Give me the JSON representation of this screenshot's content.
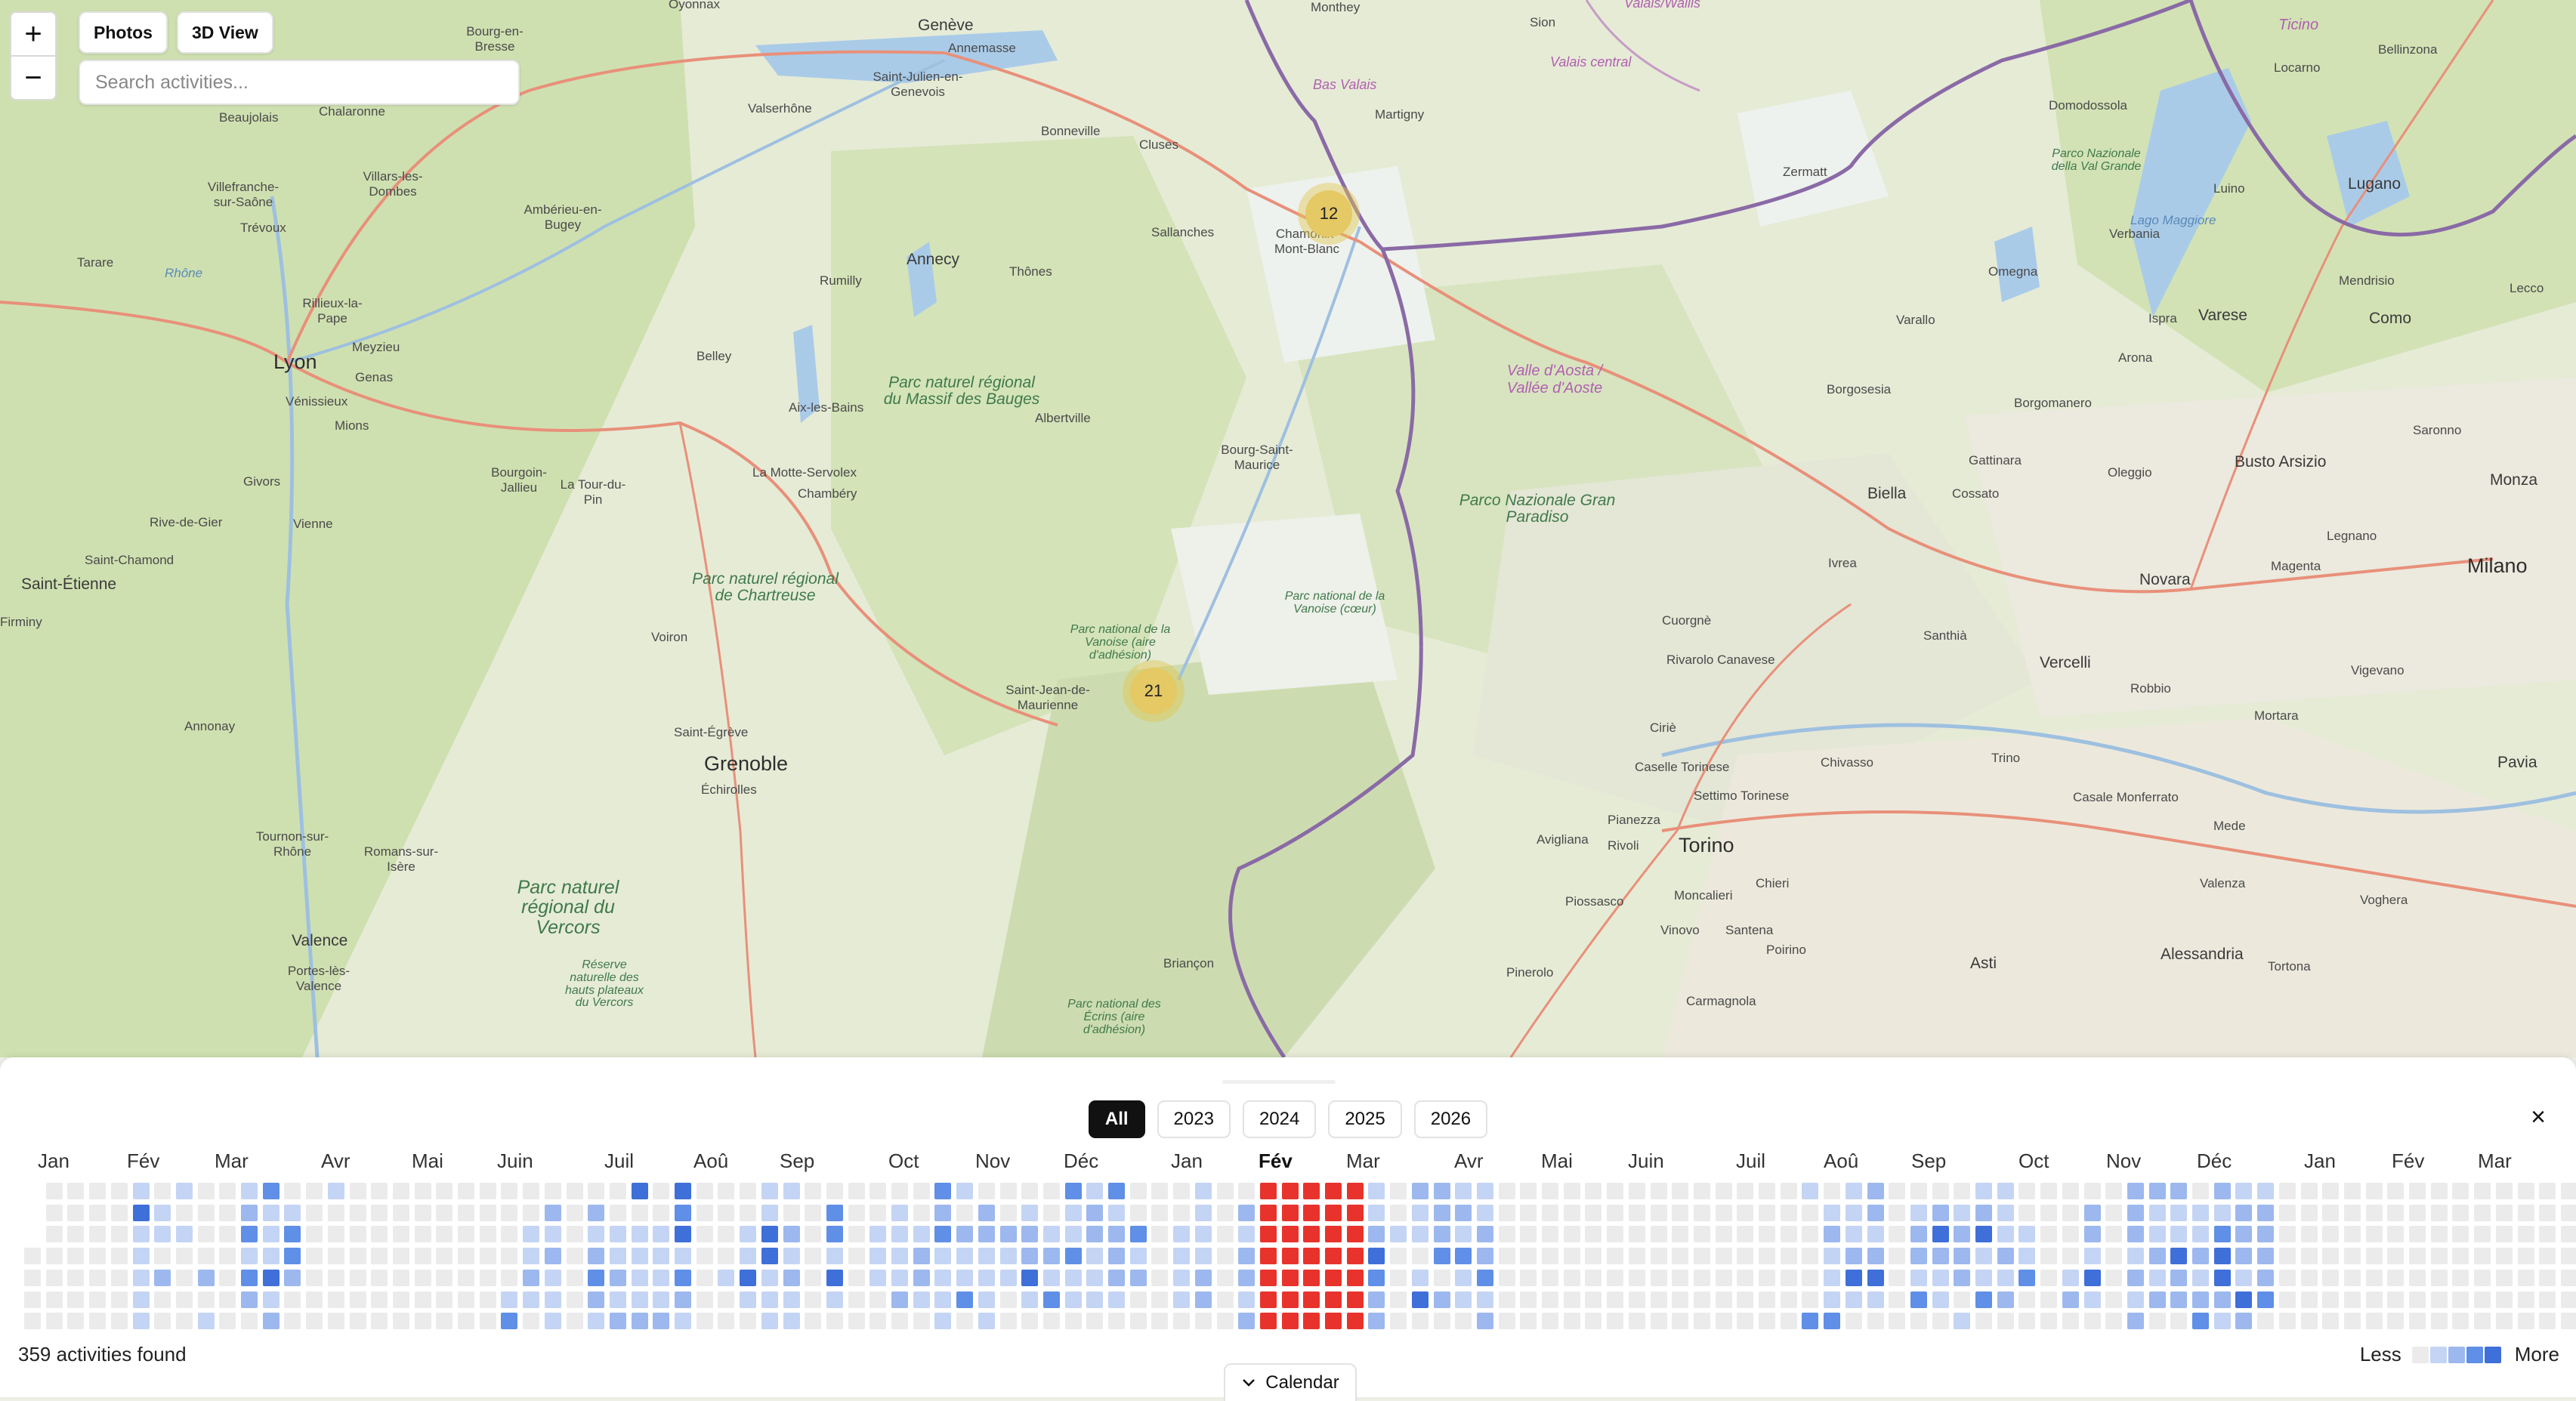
{
  "map": {
    "zoom_in": "+",
    "zoom_out": "−",
    "buttons": {
      "photos": "Photos",
      "threed": "3D View"
    },
    "search": {
      "placeholder": "Search activities..."
    },
    "clusters": [
      {
        "count": "12"
      },
      {
        "count": "21"
      }
    ],
    "labels": {
      "oyonnax": "Oyonnax",
      "geneve": "Genève",
      "annemasse": "Annemasse",
      "monthey": "Monthey",
      "sion": "Sion",
      "valais": "Valais/Wallis",
      "bourg_en_bresse": "Bourg-en-Bresse",
      "saint_julien": "Saint-Julien-en-Genevois",
      "bonneville": "Bonneville",
      "valserhone": "Valserhône",
      "chalaronne": "Chalaronne",
      "beaujolais": "Beaujolais",
      "villars": "Villars-les-Dombes",
      "villefranche": "Villefranche-sur-Saône",
      "trevoux": "Trévoux",
      "amberieu": "Ambérieu-en-Bugey",
      "tarare": "Tarare",
      "rhone": "Rhône",
      "rillieux": "Rillieux-la-Pape",
      "lyon": "Lyon",
      "venissieux": "Vénissieux",
      "meyzieu": "Meyzieu",
      "genas": "Genas",
      "mions": "Mions",
      "annecy": "Annecy",
      "rumilly": "Rumilly",
      "thones": "Thônes",
      "cluses": "Cluses",
      "sallanches": "Sallanches",
      "chamonix": "Chamonix-Mont-Blanc",
      "martigny": "Martigny",
      "bas_valais": "Bas Valais",
      "valais_central": "Valais central",
      "zermatt": "Zermatt",
      "domodossola": "Domodossola",
      "locarno": "Locarno",
      "bellinzona": "Bellinzona",
      "ticino": "Ticino",
      "lugano": "Lugano",
      "luino": "Luino",
      "verbania": "Verbania",
      "lago_maggiore": "Lago Maggiore",
      "mendrisio": "Mendrisio",
      "como": "Como",
      "lecco": "Lecco",
      "varese": "Varese",
      "omegna": "Omegna",
      "varallo": "Varallo",
      "ispra": "Ispra",
      "arona": "Arona",
      "borgosesia": "Borgosesia",
      "borgomanero": "Borgomanero",
      "gattinara": "Gattinara",
      "busto": "Busto Arsizio",
      "biella": "Biella",
      "cossato": "Cossato",
      "oleggio": "Oleggio",
      "novara": "Novara",
      "magenta": "Magenta",
      "milano": "Milano",
      "monza": "Monza",
      "belley": "Belley",
      "aix": "Aix-les-Bains",
      "albertville": "Albertville",
      "bourg_st_maurice": "Bourg-Saint-Maurice",
      "la_motte": "La Motte-Servolex",
      "chambery": "Chambéry",
      "bourgoin": "Bourgoin-Jallieu",
      "la_tour": "La Tour-du-Pin",
      "givors": "Givors",
      "vienne": "Vienne",
      "rive_de_gier": "Rive-de-Gier",
      "saint_chamond": "Saint-Chamond",
      "saint_etienne": "Saint-Étienne",
      "firminy": "Firminy",
      "annonay": "Annonay",
      "voiron": "Voiron",
      "saint_egreve": "Saint-Égrève",
      "grenoble": "Grenoble",
      "echirolles": "Échirolles",
      "saint_jean": "Saint-Jean-de-Maurienne",
      "valle_aosta": "Valle d'Aosta / Vallée d'Aoste",
      "ivrea": "Ivrea",
      "cuorgne": "Cuorgnè",
      "rivarolo": "Rivarolo Canavese",
      "santhia": "Santhià",
      "vercelli": "Vercelli",
      "robbio": "Robbio",
      "mortara": "Mortara",
      "vigevano": "Vigevano",
      "pavia": "Pavia",
      "cirie": "Ciriè",
      "caselle": "Caselle Torinese",
      "settimo": "Settimo Torinese",
      "chivasso": "Chivasso",
      "trino": "Trino",
      "casale": "Casale Monferrato",
      "torino": "Torino",
      "moncalieri": "Moncalieri",
      "chieri": "Chieri",
      "avigliana": "Avigliana",
      "rivoli": "Rivoli",
      "pianezza": "Pianezza",
      "piossasco": "Piossasco",
      "vinovo": "Vinovo",
      "santena": "Santena",
      "poirino": "Poirino",
      "asti": "Asti",
      "alessandria": "Alessandria",
      "valenza": "Valenza",
      "voghera": "Voghera",
      "tortona": "Tortona",
      "pinerolo": "Pinerolo",
      "carmagnola": "Carmagnola",
      "briancon": "Briançon",
      "valence": "Valence",
      "portes": "Portes-lès-Valence",
      "romans": "Romans-sur-Isère",
      "tournon": "Tournon-sur-Rhône",
      "mede": "Mede",
      "legnano": "Legnano",
      "saronno": "Saronno",
      "p_massif_bauges": "Parc naturel régional du Massif des Bauges",
      "p_chartreuse": "Parc naturel régional de Chartreuse",
      "p_vercors": "Parc naturel régional du Vercors",
      "p_vanoise_adh": "Parc national de la Vanoise (aire d'adhésion)",
      "p_vanoise_coeur": "Parc national de la Vanoise (cœur)",
      "p_gran_paradiso": "Parco Nazionale Gran Paradiso",
      "p_ecrins": "Parc national des Écrins (aire d'adhésion)",
      "p_val_grande": "Parco Nazionale della Val Grande",
      "reserve_vercors": "Réserve naturelle des hauts plateaux du Vercors"
    }
  },
  "calendar": {
    "years": [
      "All",
      "2023",
      "2024",
      "2025",
      "2026"
    ],
    "active_year": "All",
    "close": "×",
    "months": [
      "Jan",
      "Fév",
      "Mar",
      "Avr",
      "Mai",
      "Juin",
      "Juil",
      "Aoû",
      "Sep",
      "Oct",
      "Nov",
      "Déc",
      "Jan",
      "Fév",
      "Mar",
      "Avr",
      "Mai",
      "Juin",
      "Juil",
      "Aoû",
      "Sep",
      "Oct",
      "Nov",
      "Déc",
      "Jan",
      "Fév",
      "Mar"
    ],
    "highlight_month_index": 13,
    "activities_found": "359 activities found",
    "legend_less": "Less",
    "legend_more": "More",
    "toggle_label": "Calendar",
    "colors": {
      "empty": "#ebebeb",
      "l1": "#c4d4f4",
      "l2": "#9cb8ee",
      "l3": "#5f8fe6",
      "l4": "#3f6fd9",
      "selected": "#e8332c"
    }
  }
}
